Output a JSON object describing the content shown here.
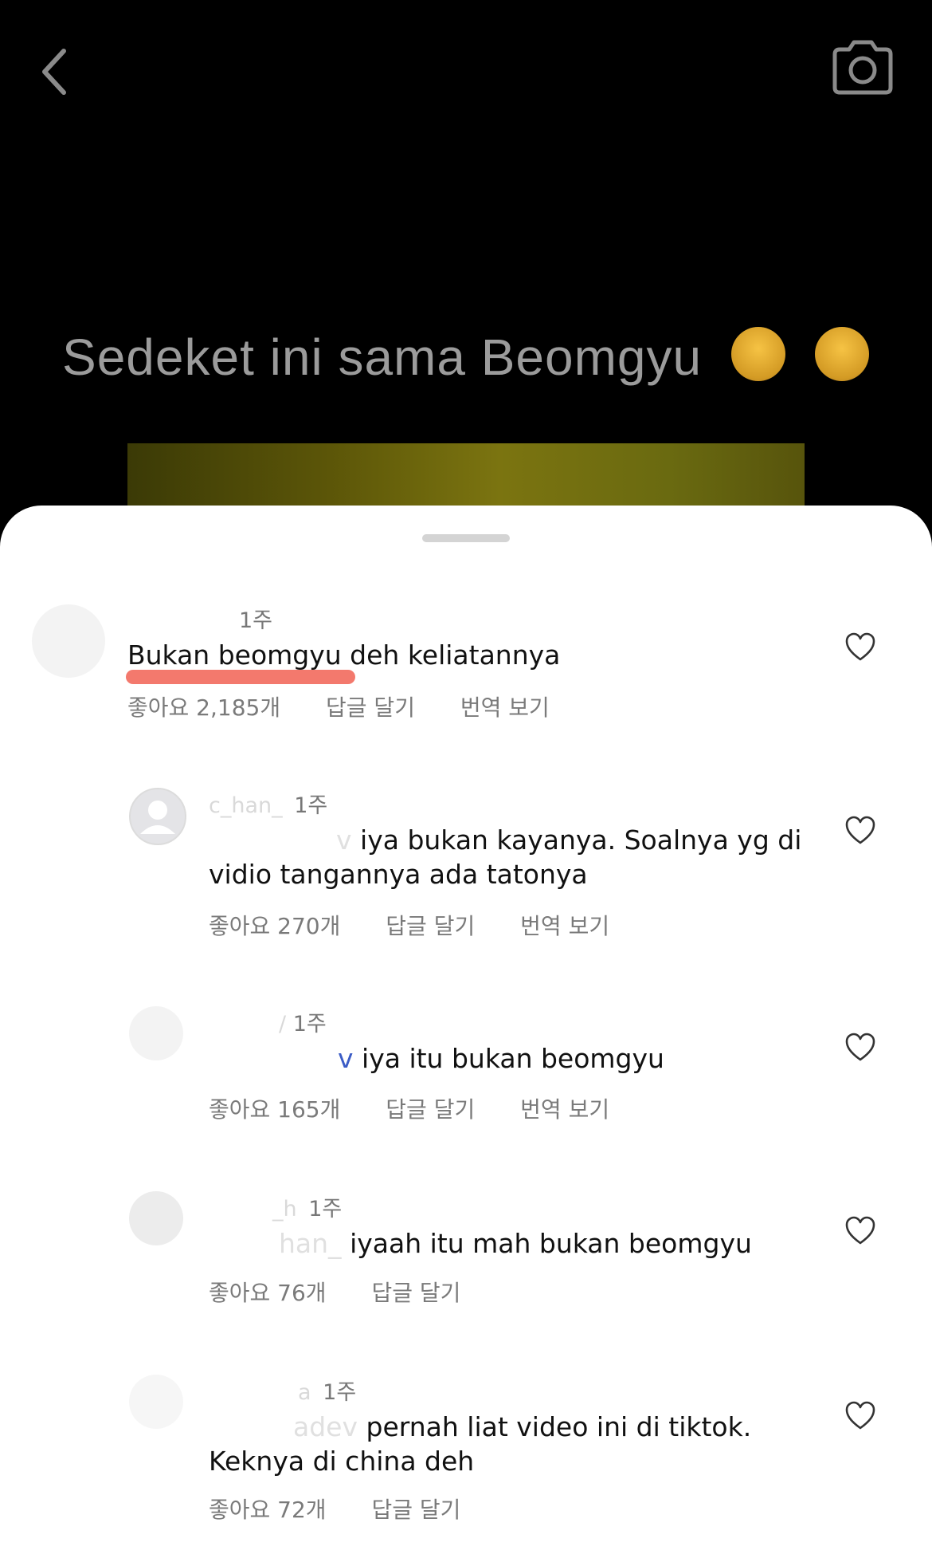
{
  "video": {
    "caption": "Sedeket ini sama Beomgyu",
    "emojis": [
      "😱",
      "😭"
    ]
  },
  "comments": [
    {
      "username": "",
      "time": "1주",
      "mention": "",
      "text": "Bukan beomgyu deh keliatannya",
      "likes": "좋아요 2,185개",
      "reply": "답글 달기",
      "translate": "번역 보기"
    },
    {
      "username": "c_han_",
      "time": "1주",
      "mention": "v",
      "text": "iya bukan kayanya. Soalnya yg di vidio tangannya ada tatonya",
      "likes": "좋아요 270개",
      "reply": "답글 달기",
      "translate": "번역 보기"
    },
    {
      "username": "/",
      "time": "1주",
      "mention": "v",
      "text": "iya itu bukan beomgyu",
      "likes": "좋아요 165개",
      "reply": "답글 달기",
      "translate": "번역 보기"
    },
    {
      "username": "_h",
      "time": "1주",
      "mention": "han_",
      "text": "iyaah itu mah bukan beomgyu",
      "likes": "좋아요 76개",
      "reply": "답글 달기"
    },
    {
      "username": "a",
      "time": "1주",
      "mention": "adev",
      "text": "pernah liat video ini di tiktok. Keknya di china deh",
      "likes": "좋아요 72개",
      "reply": "답글 달기"
    }
  ],
  "icons": {
    "back": "chevron-left-icon",
    "camera": "camera-icon",
    "like": "heart-icon",
    "avatar_placeholder": "user-placeholder-icon"
  },
  "colors": {
    "highlight_underline": "#f26a5d",
    "mention_blue": "#3b5cc6"
  }
}
